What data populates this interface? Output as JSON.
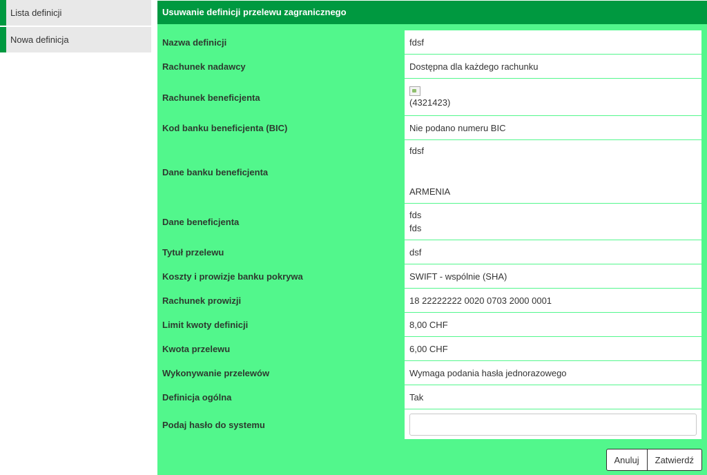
{
  "sidebar": {
    "items": [
      {
        "label": "Lista definicji"
      },
      {
        "label": "Nowa definicja"
      }
    ]
  },
  "panel": {
    "title": "Usuwanie definicji przelewu zagranicznego"
  },
  "fields": {
    "nazwa_definicji": {
      "label": "Nazwa definicji",
      "value": "fdsf"
    },
    "rachunek_nadawcy": {
      "label": "Rachunek nadawcy",
      "value": "Dostępna dla każdego rachunku"
    },
    "rachunek_beneficjenta": {
      "label": "Rachunek beneficjenta",
      "value": "(4321423)"
    },
    "kod_banku": {
      "label": "Kod banku beneficjenta (BIC)",
      "value": "Nie podano numeru BIC"
    },
    "dane_banku": {
      "label": "Dane banku beneficjenta",
      "line1": "fdsf",
      "line2": "ARMENIA"
    },
    "dane_beneficjenta": {
      "label": "Dane beneficjenta",
      "line1": "fds",
      "line2": "fds"
    },
    "tytul": {
      "label": "Tytuł przelewu",
      "value": "dsf"
    },
    "koszty": {
      "label": "Koszty i prowizje banku pokrywa",
      "value": "SWIFT - wspólnie (SHA)"
    },
    "rachunek_prowizji": {
      "label": "Rachunek prowizji",
      "value": "18 22222222 0020 0703 2000 0001"
    },
    "limit": {
      "label": "Limit kwoty definicji",
      "value": "8,00 CHF"
    },
    "kwota": {
      "label": "Kwota przelewu",
      "value": "6,00 CHF"
    },
    "wykonywanie": {
      "label": "Wykonywanie przelewów",
      "value": "Wymaga podania hasła jednorazowego"
    },
    "ogolna": {
      "label": "Definicja ogólna",
      "value": "Tak"
    },
    "haslo": {
      "label": "Podaj hasło do systemu",
      "value": ""
    }
  },
  "buttons": {
    "cancel": "Anuluj",
    "confirm": "Zatwierdź"
  },
  "colors": {
    "accent": "#009940",
    "panel_bg": "#52f78c"
  }
}
